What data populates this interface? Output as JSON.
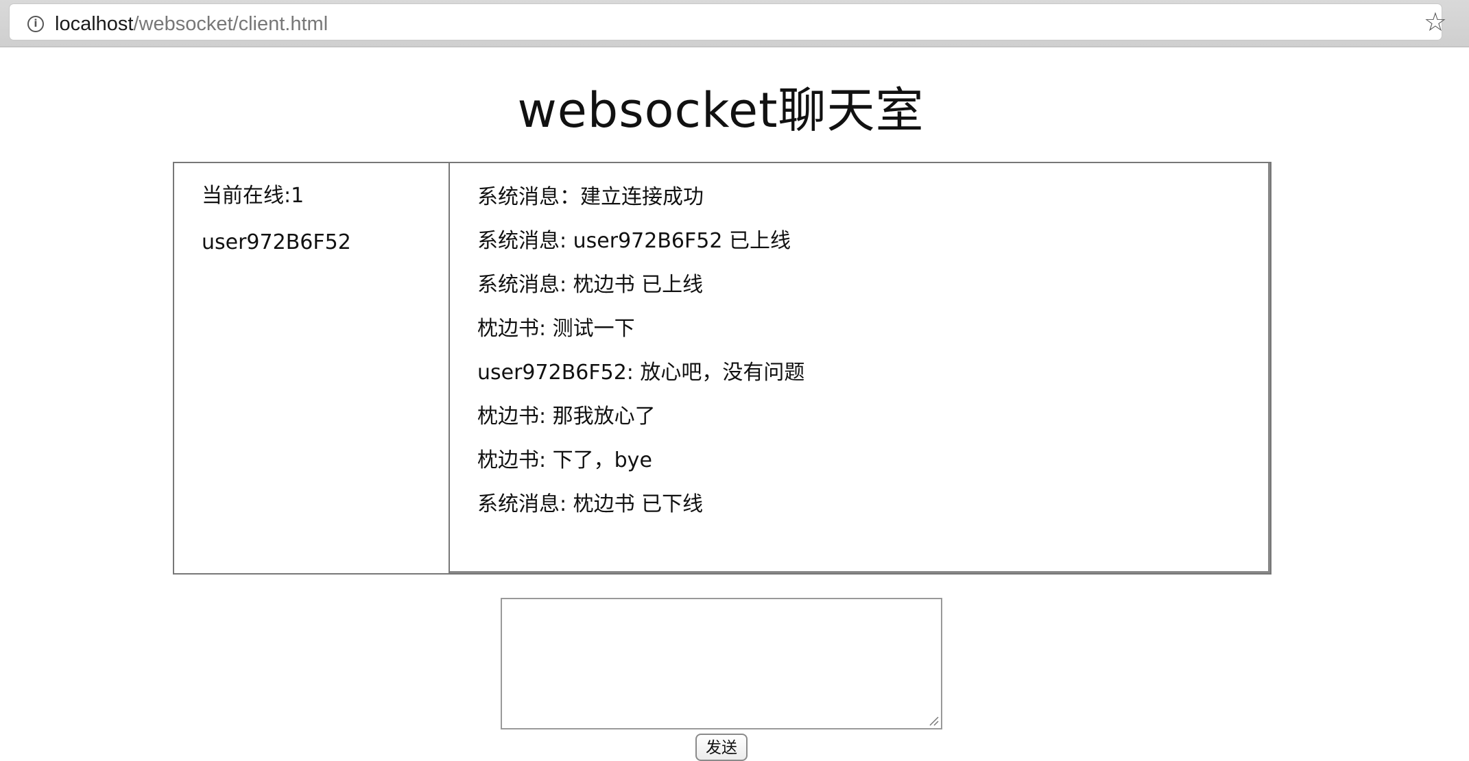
{
  "browser": {
    "url_host": "localhost",
    "url_path": "/websocket/client.html",
    "info_icon": "info-icon",
    "bookmark_icon": "star-icon"
  },
  "page": {
    "title": "websocket聊天室"
  },
  "users": {
    "online_label": "当前在线:1",
    "list": [
      "user972B6F52"
    ]
  },
  "messages": [
    "系统消息：建立连接成功",
    "系统消息: user972B6F52 已上线",
    "系统消息: 枕边书 已上线",
    "枕边书: 测试一下",
    "user972B6F52: 放心吧，没有问题",
    "枕边书: 那我放心了",
    "枕边书: 下了，bye",
    "系统消息: 枕边书 已下线"
  ],
  "composer": {
    "input_value": "",
    "send_label": "发送"
  }
}
